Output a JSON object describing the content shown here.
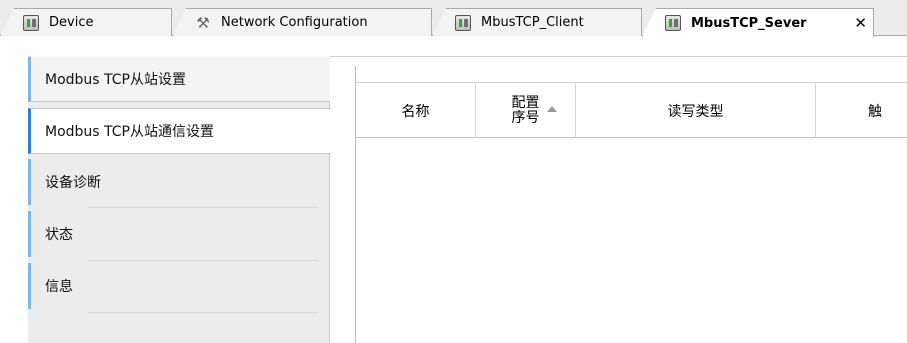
{
  "tabs": [
    {
      "label": "Device",
      "icon": "device-icon",
      "active": false
    },
    {
      "label": "Network Configuration",
      "icon": "wrench-icon",
      "active": false
    },
    {
      "label": "MbusTCP_Client",
      "icon": "device-icon",
      "active": false
    },
    {
      "label": "MbusTCP_Sever",
      "icon": "device-icon",
      "active": true,
      "close": "✕"
    }
  ],
  "sidebar": {
    "items": [
      {
        "label": "Modbus TCP从站设置"
      },
      {
        "label": "Modbus TCP从站通信设置"
      },
      {
        "label": "设备诊断"
      },
      {
        "label": "状态"
      },
      {
        "label": "信息"
      }
    ]
  },
  "grid": {
    "columns": [
      {
        "label": "名称"
      },
      {
        "label_line1": "配置",
        "label_line2": "序号"
      },
      {
        "label": "读写类型"
      },
      {
        "label": "触"
      }
    ]
  },
  "colors": {
    "accent_active": "#2b7fd6",
    "accent_inactive": "#7db6e8",
    "sidebar_bg": "#ececec"
  }
}
